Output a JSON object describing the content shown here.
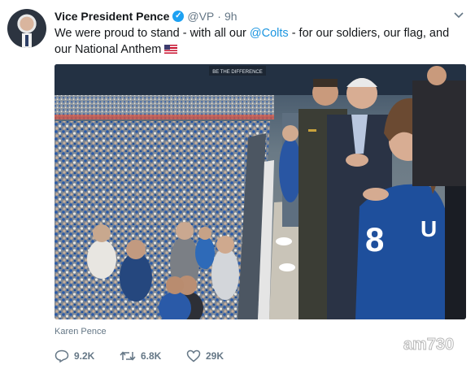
{
  "tweet": {
    "author_name": "Vice President Pence",
    "handle": "@VP",
    "separator": "·",
    "time": "9h",
    "text_part1": "We were proud to stand - with all our ",
    "mention": "@Colts",
    "text_part2": " - for our soldiers, our flag, and our National Anthem",
    "text_emoji": "us-flag-emoji",
    "media_caption": "Karen Pence",
    "stats": {
      "replies": "9.2K",
      "retweets": "6.8K",
      "likes": "29K"
    }
  },
  "photo": {
    "scoreboard_text": "BE THE DIFFERENCE",
    "jersey_left_number": "8",
    "jersey_right_label": "U"
  },
  "watermark": "am730",
  "icons": [
    "verified-badge-icon",
    "dropdown-caret-icon",
    "reply-icon",
    "retweet-icon",
    "like-icon"
  ],
  "colors": {
    "link": "#1b95e0",
    "verified": "#1da1f2",
    "secondary_text": "#657786",
    "colts_blue": "#1e4f9c"
  }
}
